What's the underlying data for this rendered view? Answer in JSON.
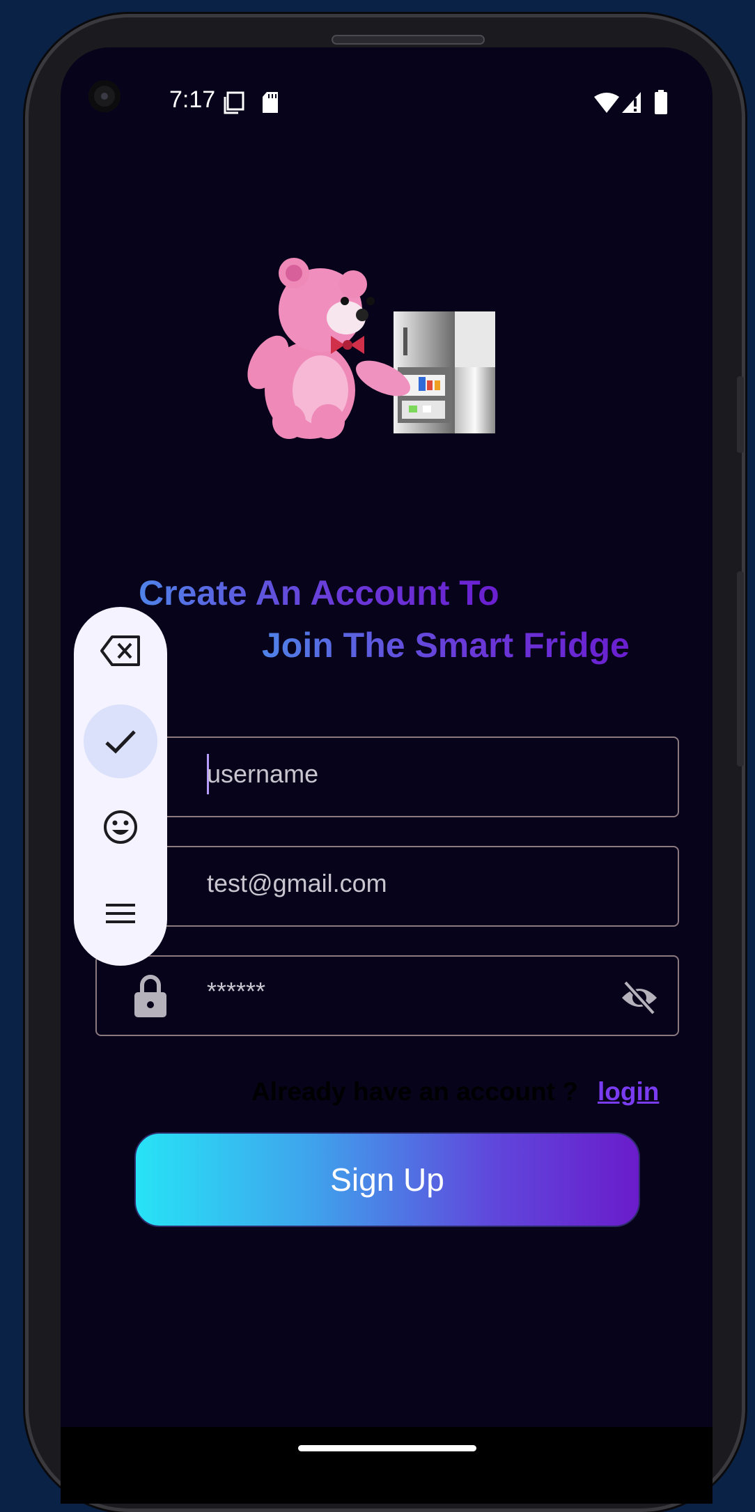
{
  "status_bar": {
    "time": "7:17",
    "icons": [
      "screen-record-icon",
      "sd-card-icon",
      "wifi-icon",
      "signal-icon",
      "battery-icon"
    ]
  },
  "hero": {
    "illustration": "teddy-bear-fridge-illustration"
  },
  "headline": {
    "line1": "Create An Account To",
    "line2": "Join The Smart Fridge",
    "gradient_colors": [
      "#4f83e8",
      "#6a1fd0"
    ]
  },
  "form": {
    "username": {
      "placeholder": "username",
      "value": ""
    },
    "email": {
      "value": "test@gmail.com"
    },
    "password": {
      "value": "******"
    }
  },
  "login_prompt": {
    "text": "Already have an account ?",
    "link": "login"
  },
  "signup_button": {
    "label": "Sign Up",
    "gradient_colors": [
      "#27e3f6",
      "#6a1ccb"
    ]
  },
  "keyboard_toolbar": {
    "items": [
      "backspace-icon",
      "check-icon",
      "emoji-icon",
      "menu-icon"
    ],
    "active_item": "check-icon"
  },
  "colors": {
    "background": "#07031a",
    "accent": "#7a3cf0",
    "field_border": "#8b7a80"
  }
}
